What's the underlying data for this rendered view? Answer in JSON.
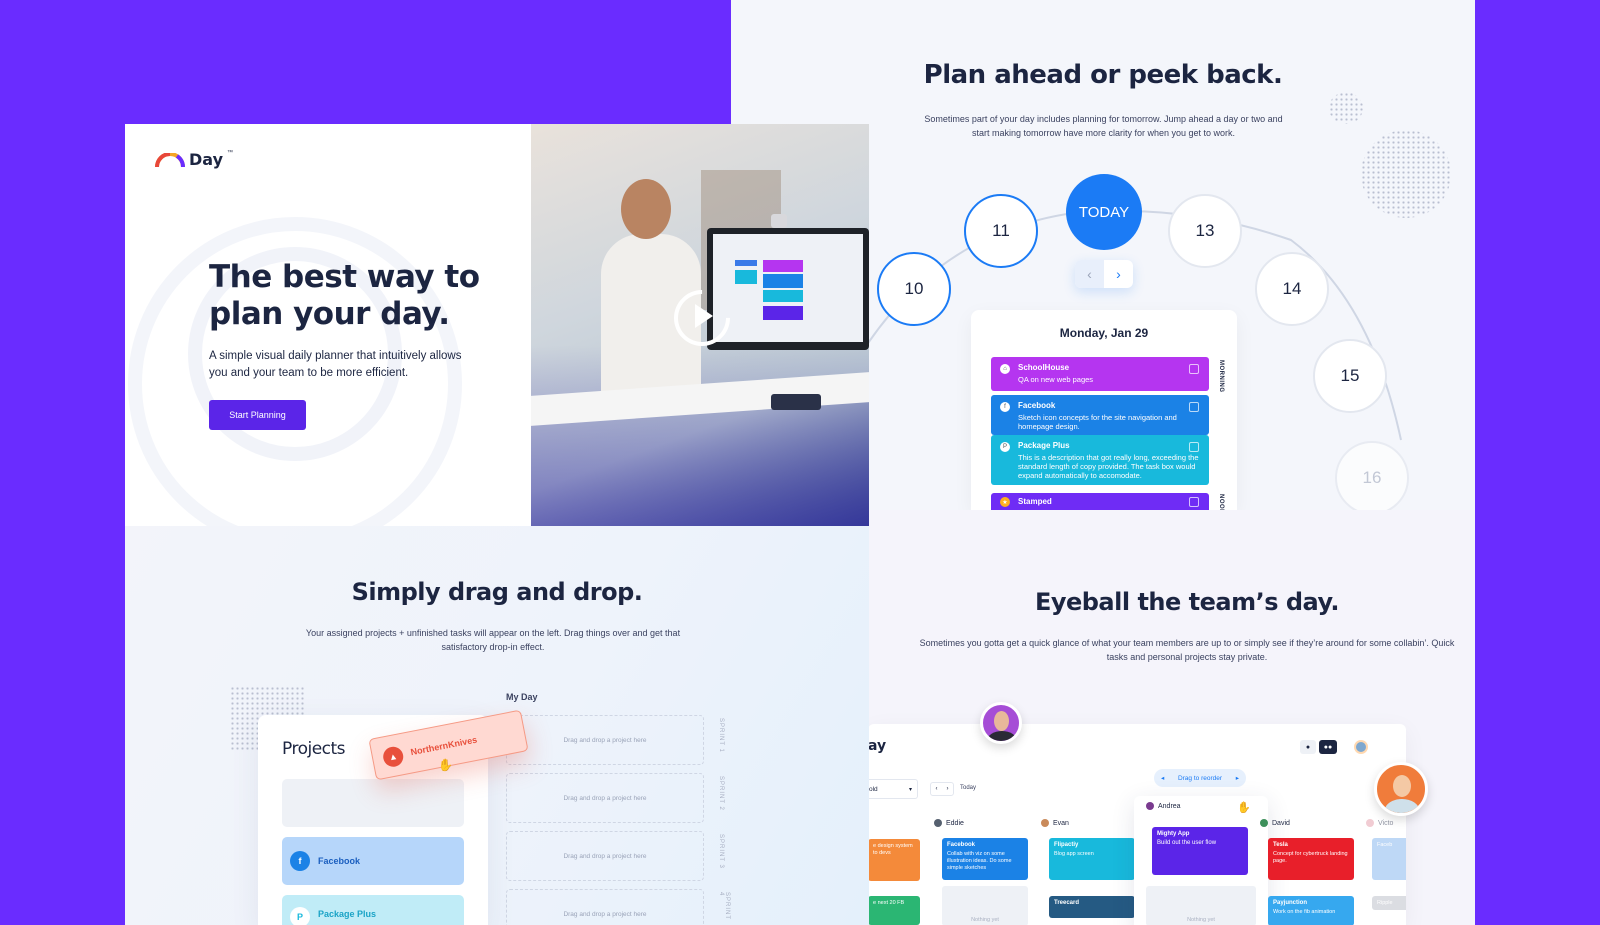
{
  "hero": {
    "logo_text": "Day",
    "logo_tm": "™",
    "headline": "The best way to plan your day.",
    "subtext": "A simple visual daily planner that intuitively allows you and your team to be more efficient.",
    "cta_label": "Start Planning"
  },
  "plan_ahead": {
    "title": "Plan ahead or peek back.",
    "subtext": "Sometimes part of your day includes planning for tomorrow. Jump ahead a day or two and start making tomorrow have more clarity for when you get to work.",
    "days": {
      "d10": "10",
      "d11": "11",
      "today": "TODAY",
      "d13": "13",
      "d14": "14",
      "d15": "15",
      "d16": "16"
    },
    "date_label": "Monday, Jan 29",
    "side_morning": "MORNING",
    "side_noon": "NOON",
    "tasks": [
      {
        "name": "SchoolHouse",
        "desc": "QA on new web pages",
        "color": "#b535f0"
      },
      {
        "name": "Facebook",
        "desc": "Sketch icon concepts for the site navigation and homepage design.",
        "color": "#1b82e6"
      },
      {
        "name": "Package Plus",
        "desc": "This is a description that got really long, exceeding the standard length of copy provided. The task box would expand automatically to accomodate.",
        "color": "#18b9dc"
      },
      {
        "name": "Stamped",
        "desc": "",
        "color": "#6f2cf5"
      }
    ]
  },
  "drag_drop": {
    "title": "Simply drag and drop.",
    "subtext": "Your assigned projects + unfinished tasks will appear on the left. Drag things over and get that satisfactory drop-in effect.",
    "my_day_label": "My Day",
    "projects_title": "Projects",
    "dragging_project": "NorthernKnives",
    "projects": [
      "Facebook",
      "Package Plus"
    ],
    "slot_placeholder": "Drag and drop a project here",
    "sprints": [
      "SPRINT 1",
      "SPRINT 2",
      "SPRINT 3",
      "SPRINT 4"
    ]
  },
  "team": {
    "title": "Eyeball the team’s day.",
    "subtext": "Sometimes you gotta get a quick glance of what your team members are up to or simply see if they’re around for some collabin’. Quick tasks and personal projects stay private.",
    "logo_fragment": "ay",
    "drag_to_reorder": "Drag to reorder",
    "select_fragment": "old",
    "today_label": "Today",
    "members": [
      "Eddie",
      "Evan",
      "Andrea",
      "David",
      "Victo"
    ],
    "cards": {
      "left_partial": "e design system\nto devs",
      "left_partial2": "e next 20 FB",
      "eddie_title": "Facebook",
      "eddie_desc": "Collab with viz on some illustration ideas. Do some simple sketches",
      "eddie_empty": "Nothing yet",
      "evan_title": "Flipactiy",
      "evan_desc": "Blog app screen",
      "evan_title2": "Treecard",
      "andrea_title": "Mighty App",
      "andrea_desc": "Build out the user flow",
      "andrea_empty": "Nothing yet",
      "david_title": "Tesla",
      "david_desc": "Concept for cybertruck landing page.",
      "david_title2": "Payjunction",
      "david_desc2": "Work on the fib animation",
      "victo_title": "Faceb",
      "victo_title2": "Ripple"
    }
  },
  "colors": {
    "brand_purple": "#6a2cff",
    "primary_blue": "#1b7bf5",
    "cta": "#5b25e8"
  }
}
